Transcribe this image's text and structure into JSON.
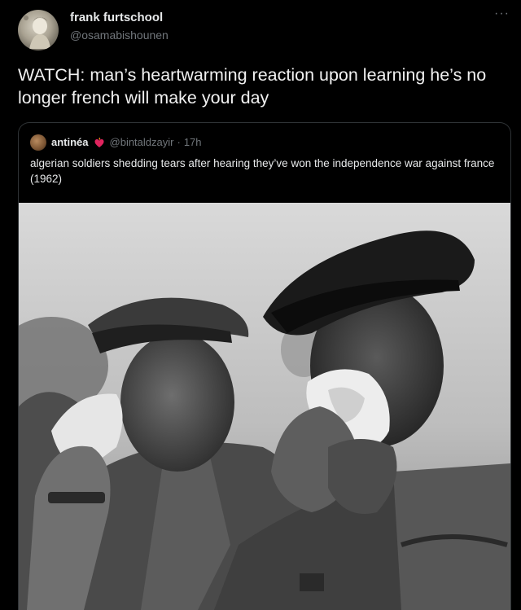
{
  "tweet": {
    "author": {
      "display_name": "frank furtschool",
      "handle": "@osamabishounen",
      "avatar_icon": "profile-avatar"
    },
    "more_label": "···",
    "text": "WATCH: man’s heartwarming reaction upon learning he’s no longer french will make your day"
  },
  "quoted_tweet": {
    "author": {
      "display_name": "antinéa",
      "emoji_icon": "flame-heart-icon",
      "handle": "@bintaldzayir",
      "separator": "·",
      "time": "17h"
    },
    "text": "algerian soldiers shedding tears after hearing they’ve won the independence war against france (1962)",
    "media": {
      "type": "photo",
      "style": "black-and-white"
    }
  },
  "colors": {
    "background": "#000000",
    "primary_text": "#e7e9ea",
    "secondary_text": "#71767b",
    "border": "#2f3336"
  }
}
